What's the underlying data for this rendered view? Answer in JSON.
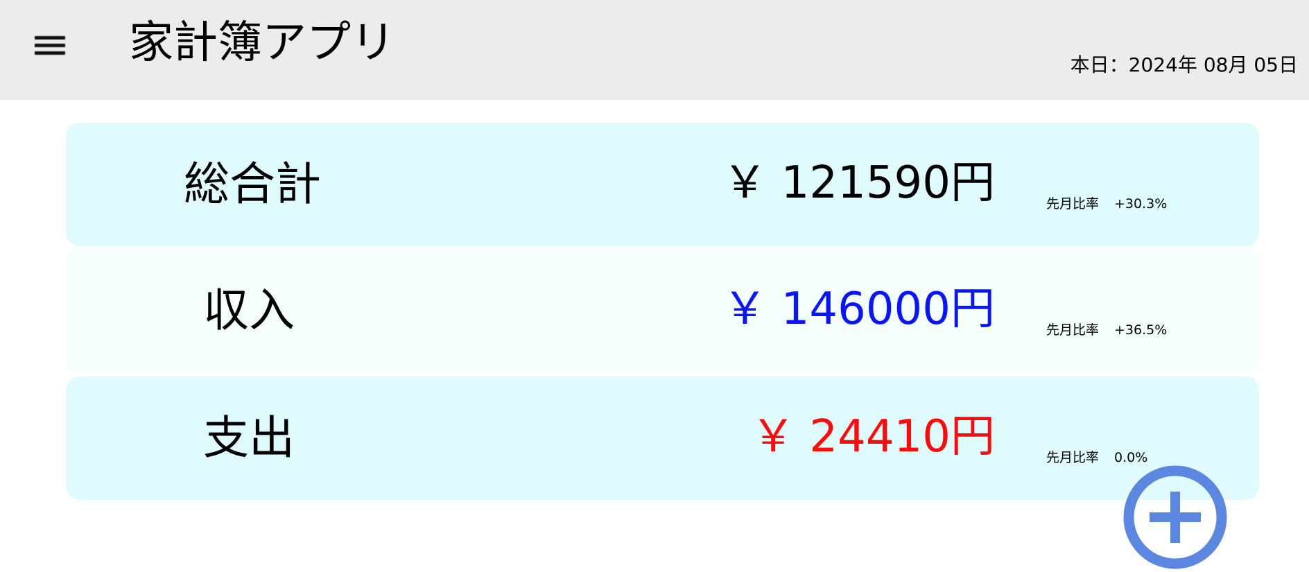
{
  "header": {
    "menu_icon": "hamburger-icon",
    "title": "家計簿アプリ",
    "date": "本日：2024年 08月 05日"
  },
  "summary": [
    {
      "label": "総合計",
      "amount": "￥ 121590円",
      "ratio_label": "先月比率",
      "ratio_value": "+30.3%",
      "color": "#000000"
    },
    {
      "label": "収入",
      "amount": "￥ 146000円",
      "ratio_label": "先月比率",
      "ratio_value": "+36.5%",
      "color": "#0a14ff"
    },
    {
      "label": "支出",
      "amount": "￥ 24410円",
      "ratio_label": "先月比率",
      "ratio_value": "0.0%",
      "color": "#ff0a0a"
    }
  ],
  "fab": {
    "icon": "plus-circle-icon",
    "color": "#5b87e0"
  }
}
